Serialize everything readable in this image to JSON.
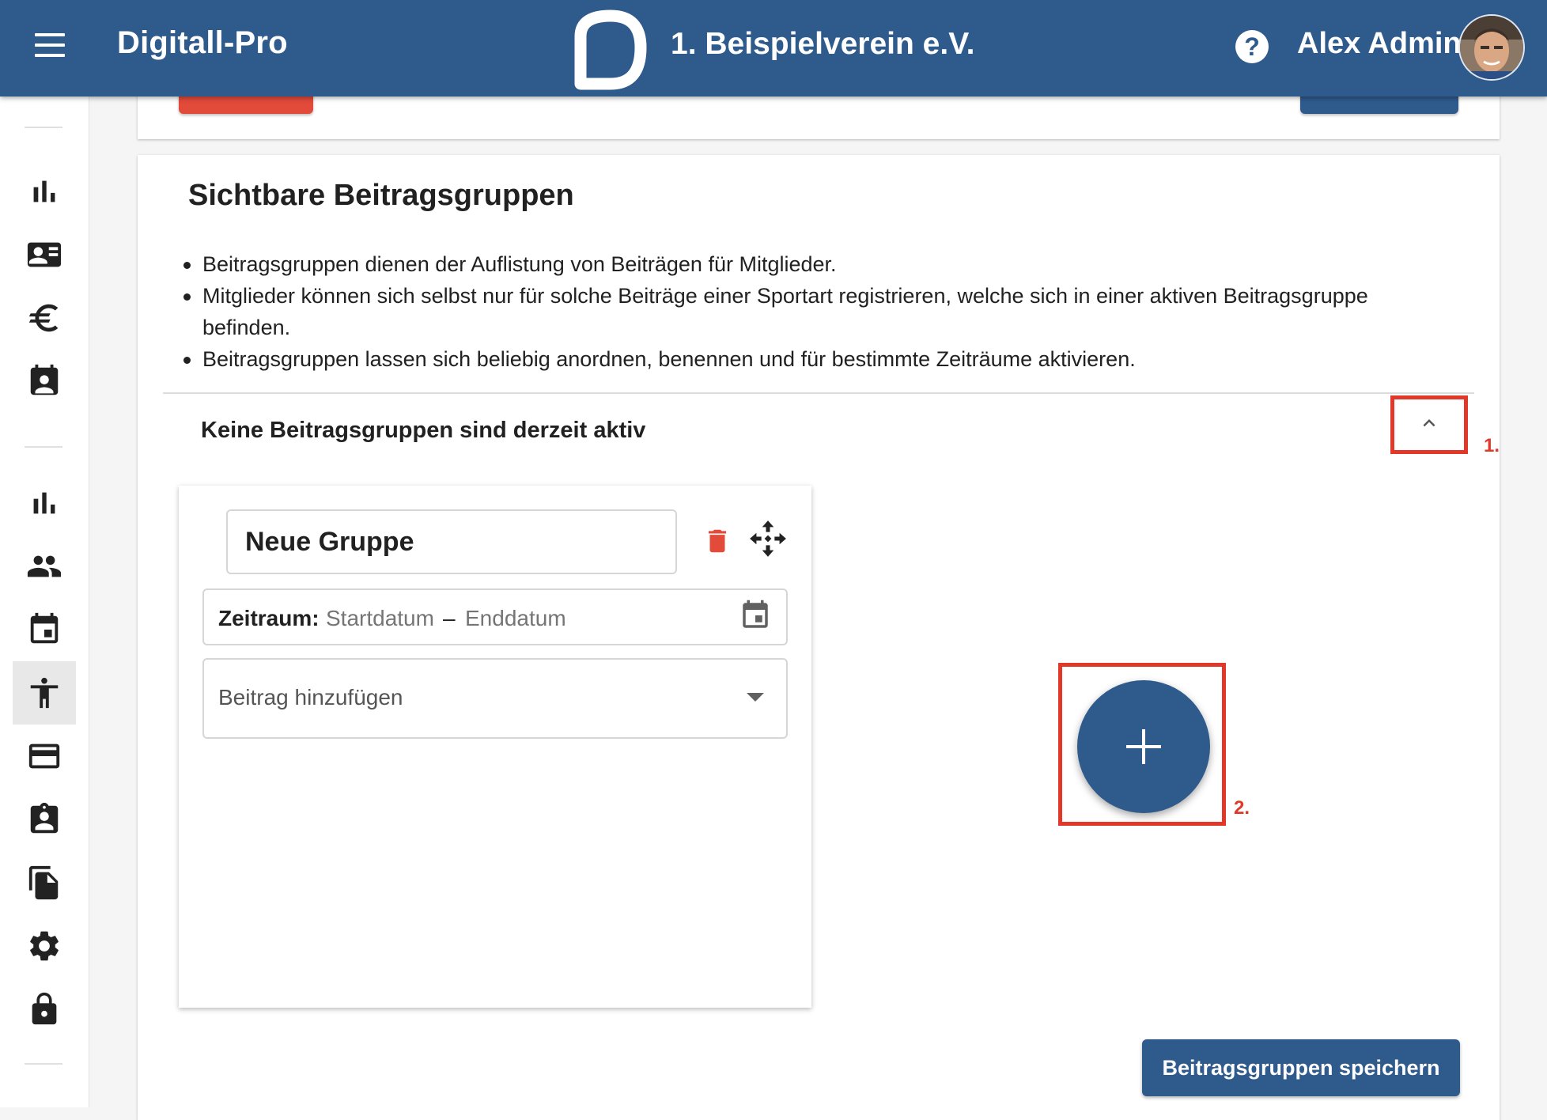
{
  "header": {
    "app_title": "Digitall-Pro",
    "club_name": "1. Beispielverein e.V.",
    "help_icon": "help-circle-icon",
    "user_name": "Alex Admin",
    "background_color": "#2f5a8c"
  },
  "sidebar": {
    "items": [
      {
        "icon": "bar-chart-icon"
      },
      {
        "icon": "contact-card-icon"
      },
      {
        "icon": "euro-icon"
      },
      {
        "icon": "calendar-person-icon"
      },
      {
        "icon": "bar-chart-icon"
      },
      {
        "icon": "people-icon"
      },
      {
        "icon": "calendar-icon"
      },
      {
        "icon": "sport-figure-icon",
        "active": true
      },
      {
        "icon": "credit-card-icon"
      },
      {
        "icon": "clipboard-person-icon"
      },
      {
        "icon": "documents-icon"
      },
      {
        "icon": "gear-icon"
      },
      {
        "icon": "lock-icon"
      }
    ]
  },
  "section": {
    "title": "Sichtbare Beitragsgruppen",
    "bullets": [
      "Beitragsgruppen dienen der Auflistung von Beiträgen für Mitglieder.",
      "Mitglieder können sich selbst nur für solche Beiträge einer Sportart registrieren, welche sich in einer aktiven Beitragsgruppe befinden.",
      "Beitragsgruppen lassen sich beliebig anordnen, benennen und für bestimmte Zeiträume aktivieren."
    ],
    "status": "Keine Beitragsgruppen sind derzeit aktiv"
  },
  "group": {
    "name": "Neue Gruppe",
    "period_label": "Zeitraum:",
    "start_placeholder": "Startdatum",
    "dash": "–",
    "end_placeholder": "Enddatum",
    "fee_placeholder": "Beitrag hinzufügen"
  },
  "annotations": {
    "marker_1": "1.",
    "marker_2": "2.",
    "color": "#e2382a"
  },
  "save_button_label": "Beitragsgruppen speichern",
  "colors": {
    "primary": "#2f5a8c",
    "danger": "#e24a3a"
  }
}
